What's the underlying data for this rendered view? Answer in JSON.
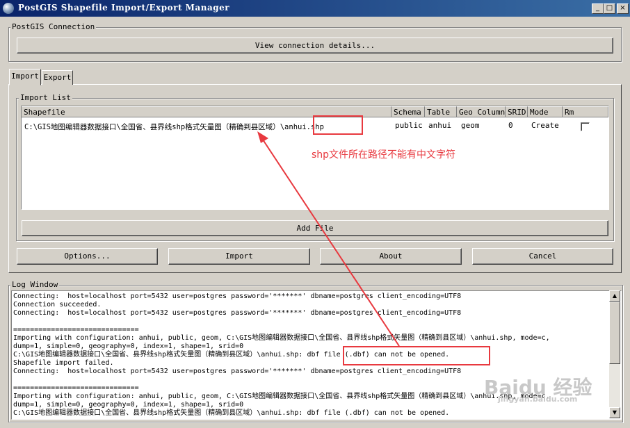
{
  "window": {
    "title": "PostGIS Shapefile Import/Export Manager",
    "controls": {
      "minimize": "_",
      "maximize": "□",
      "close": "×"
    }
  },
  "connection": {
    "group_label": "PostGIS Connection",
    "view_button": "View connection details..."
  },
  "tabs": [
    "Import",
    "Export"
  ],
  "import_list": {
    "group_label": "Import List",
    "columns": [
      "Shapefile",
      "Schema",
      "Table",
      "Geo Column",
      "SRID",
      "Mode",
      "Rm"
    ],
    "rows": [
      {
        "shapefile_dir": "C:\\GIS地图编辑器数据接口\\全国省、县界线shp格式矢量图（精确到县区域）\\",
        "shapefile_name": "anhui.shp",
        "schema": "public",
        "table": "anhui",
        "geo_column": "geom",
        "srid": "0",
        "mode": "Create"
      }
    ],
    "add_file_button": "Add File"
  },
  "actions": {
    "options": "Options...",
    "import": "Import",
    "about": "About",
    "cancel": "Cancel"
  },
  "log": {
    "group_label": "Log Window",
    "lines": [
      "Connecting:  host=localhost port=5432 user=postgres password='*******' dbname=postgres client_encoding=UTF8",
      "Connection succeeded.",
      "Connecting:  host=localhost port=5432 user=postgres password='*******' dbname=postgres client_encoding=UTF8",
      "",
      "==============================",
      "Importing with configuration: anhui, public, geom, C:\\GIS地图编辑器数据接口\\全国省、县界线shp格式矢量图（精确到县区域）\\anhui.shp, mode=c,",
      "dump=1, simple=0, geography=0, index=1, shape=1, srid=0",
      "C:\\GIS地图编辑器数据接口\\全国省、县界线shp格式矢量图（精确到县区域）\\anhui.shp: dbf file (.dbf) can not be opened.",
      "Shapefile import failed.",
      "Connecting:  host=localhost port=5432 user=postgres password='*******' dbname=postgres client_encoding=UTF8",
      "",
      "==============================",
      "Importing with configuration: anhui, public, geom, C:\\GIS地图编辑器数据接口\\全国省、县界线shp格式矢量图（精确到县区域）\\anhui.shp, mode=c,",
      "dump=1, simple=0, geography=0, index=1, shape=1, srid=0",
      "C:\\GIS地图编辑器数据接口\\全国省、县界线shp格式矢量图（精确到县区域）\\anhui.shp: dbf file (.dbf) can not be opened."
    ]
  },
  "annotation": {
    "note": "shp文件所在路径不能有中文字符",
    "color": "#e8393f"
  },
  "watermark": {
    "brand": "Baidu 经验",
    "url": "jingyan.baidu.com"
  },
  "colors": {
    "face": "#d4d0c8",
    "titlebar_start": "#0a246a",
    "titlebar_end": "#3a6ea5"
  }
}
